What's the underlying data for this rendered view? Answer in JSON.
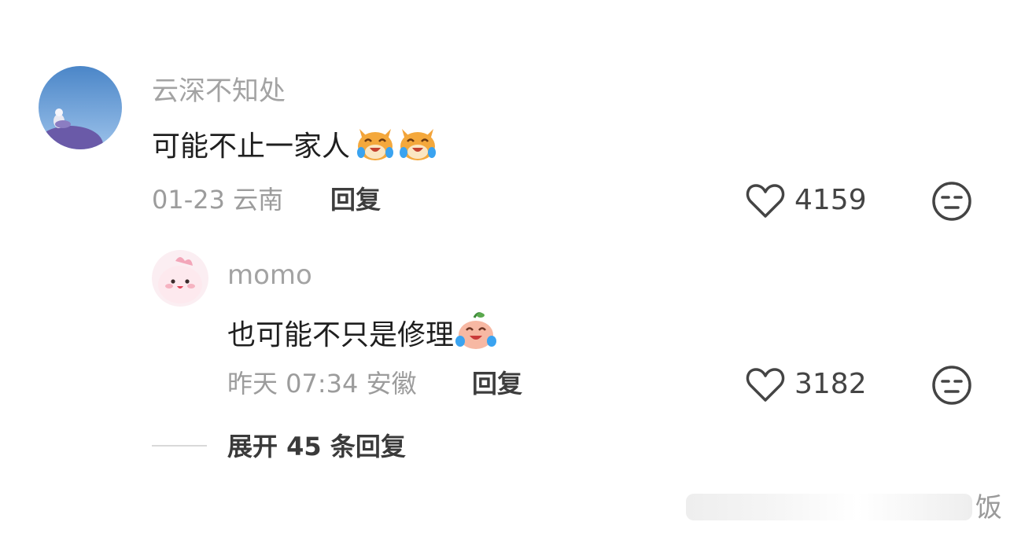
{
  "comments": [
    {
      "user": "云深不知处",
      "text": "可能不止一家人",
      "emoji": [
        "cat-crying-laughing-icon",
        "cat-crying-laughing-icon"
      ],
      "date": "01-23",
      "location": "云南",
      "reply_label": "回复",
      "likes": "4159"
    }
  ],
  "reply": {
    "user": "momo",
    "text": "也可能不只是修理",
    "emoji": [
      "peach-crying-laughing-icon"
    ],
    "date": "昨天 07:34",
    "location": "安徽",
    "reply_label": "回复",
    "likes": "3182"
  },
  "expand": {
    "label": "展开 45 条回复"
  },
  "watermark": {
    "text": "饭"
  }
}
